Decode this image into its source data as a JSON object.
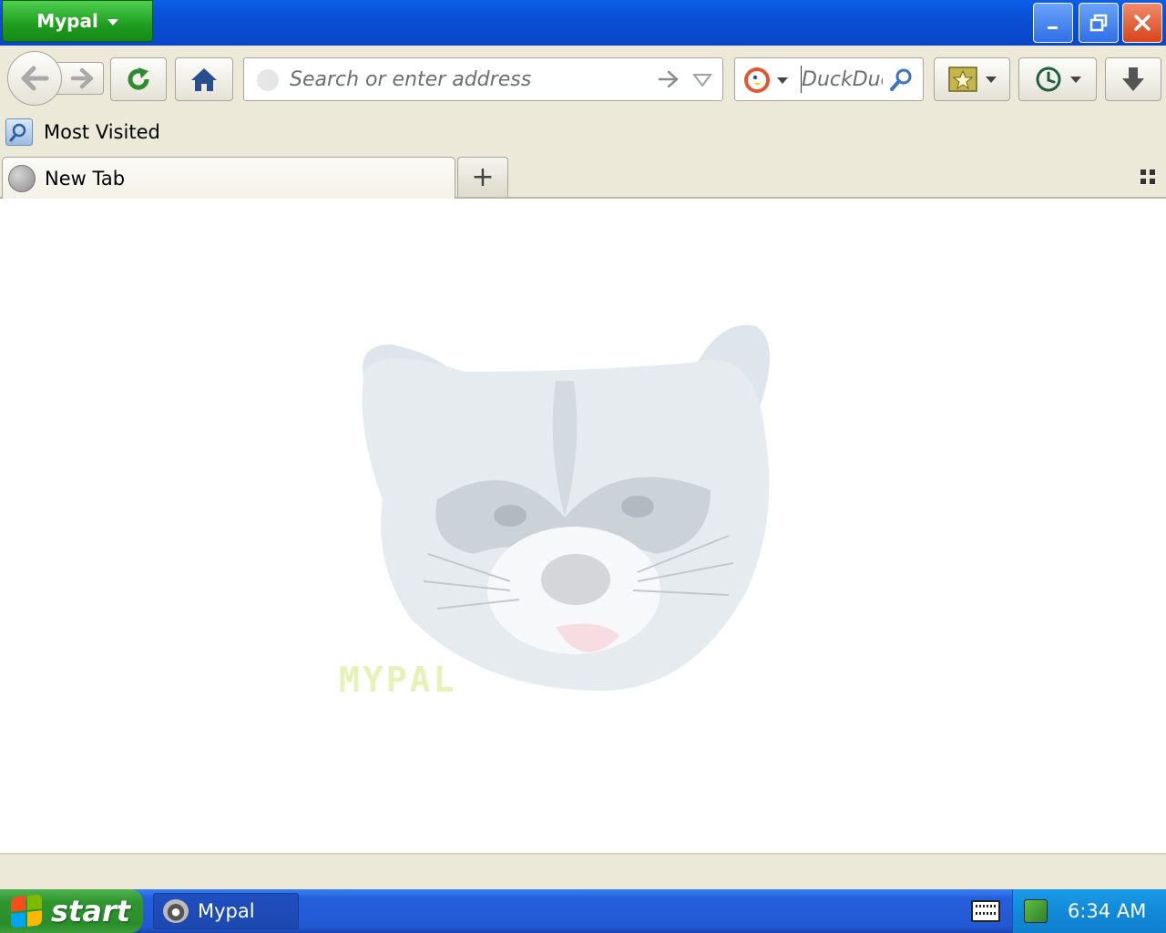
{
  "window": {
    "app_menu_label": "Mypal",
    "controls": {
      "minimize": "minimize-icon",
      "restore": "restore-icon",
      "close": "close-icon"
    }
  },
  "navbar": {
    "back_icon": "back-arrow-icon",
    "forward_icon": "forward-arrow-icon",
    "reload_icon": "reload-icon",
    "home_icon": "home-icon",
    "url_placeholder": "Search or enter address",
    "url_value": "",
    "search_engine_icon": "duckduckgo-icon",
    "search_placeholder": "DuckDuc",
    "bookmarks_icon": "bookmark-star-icon",
    "history_icon": "clock-icon",
    "downloads_icon": "download-arrow-icon"
  },
  "bookmarks_bar": {
    "items": [
      {
        "label": "Most Visited",
        "icon": "most-visited-folder-icon"
      }
    ]
  },
  "tabs": {
    "items": [
      {
        "label": "New Tab",
        "icon": "globe-icon",
        "active": true
      }
    ],
    "new_tab_label": "+",
    "list_all_icon": "tab-grid-icon"
  },
  "content": {
    "watermark_image": "raccoon-face",
    "watermark_text": "MYPAL"
  },
  "taskbar": {
    "start_label": "start",
    "tasks": [
      {
        "label": "Mypal",
        "icon": "raccoon-icon"
      }
    ],
    "clock": "6:34 AM"
  },
  "colors": {
    "titlebar": "#0b4fd6",
    "app_menu": "#2a9f2a",
    "close_button": "#d9441b",
    "reload_green": "#2e8b2e",
    "home_blue": "#2a4d8f",
    "taskbar": "#245fdc",
    "tray": "#118ad9"
  }
}
